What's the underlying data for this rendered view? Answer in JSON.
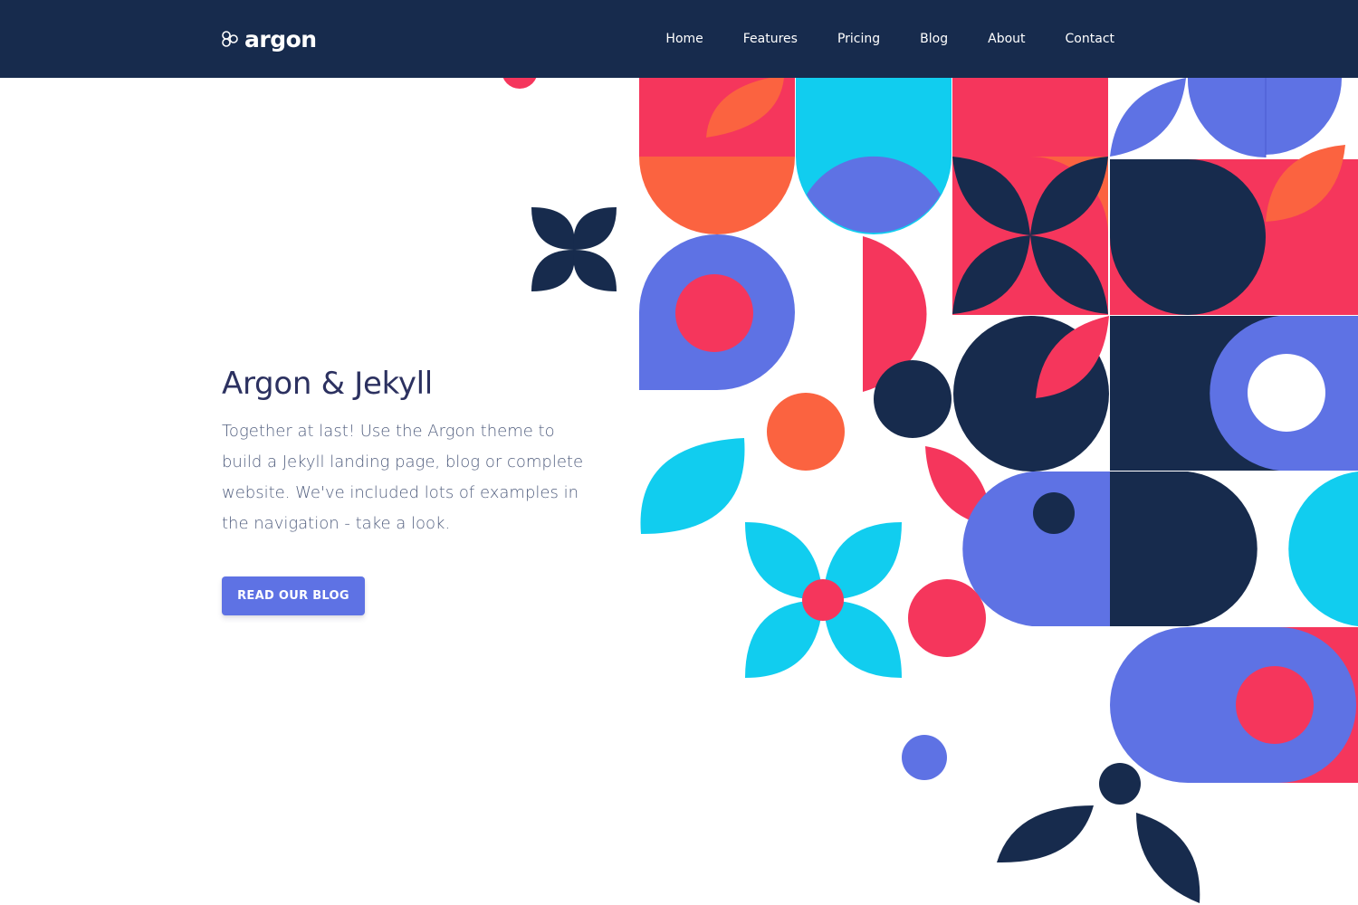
{
  "brand": {
    "name": "argon"
  },
  "nav": {
    "items": [
      {
        "label": "Home"
      },
      {
        "label": "Features"
      },
      {
        "label": "Pricing"
      },
      {
        "label": "Blog"
      },
      {
        "label": "About"
      },
      {
        "label": "Contact"
      }
    ]
  },
  "hero": {
    "title": "Argon & Jekyll",
    "description": "Together at last! Use the Argon theme to build a Jekyll landing page, blog or complete website. We've included lots of examples in the navigation - take a look.",
    "button_label": "READ OUR BLOG"
  },
  "colors": {
    "navbar": "#172b4d",
    "primary": "#5e72e4",
    "red": "#f5365c",
    "orange": "#fb6340",
    "cyan": "#11cdef",
    "navy": "#172b4d",
    "indigo": "#5e72e4"
  },
  "icons": {
    "brand_logo": "hexagon-cluster-icon"
  }
}
